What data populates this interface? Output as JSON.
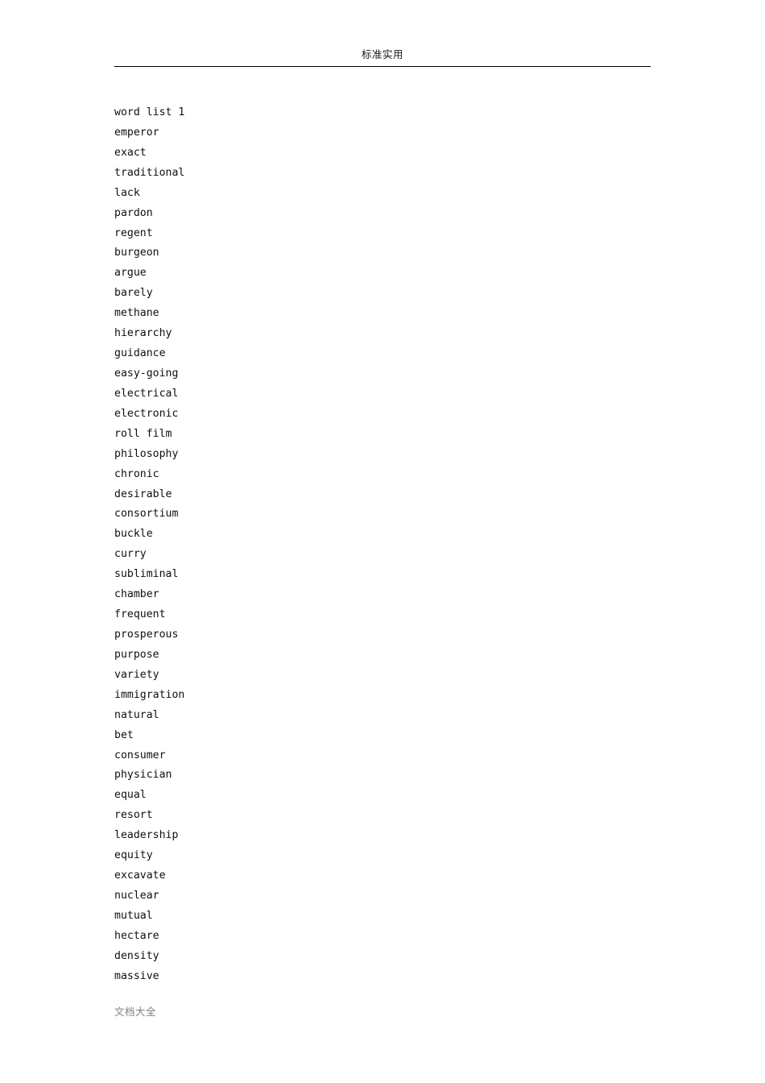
{
  "header": {
    "title": "标准实用"
  },
  "footer": {
    "text": "文档大全"
  },
  "document": {
    "words": [
      "word list 1",
      "emperor",
      "exact",
      "traditional",
      "lack",
      "pardon",
      "regent",
      "burgeon",
      "argue",
      "barely",
      "methane",
      "hierarchy",
      "guidance",
      "easy-going",
      "electrical",
      "electronic",
      "roll film",
      "philosophy",
      "chronic",
      "desirable",
      "consortium",
      "buckle",
      "curry",
      "subliminal",
      "chamber",
      "frequent",
      "prosperous",
      "purpose",
      "variety",
      "immigration",
      "natural",
      "bet",
      "consumer",
      "physician",
      "equal",
      "resort",
      "leadership",
      "equity",
      "excavate",
      "nuclear",
      "mutual",
      "hectare",
      "density",
      "massive"
    ]
  },
  "colors": {
    "text": "#101010",
    "header_text": "#1a1a1a",
    "footer_text": "#808080",
    "rule": "#000000",
    "background": "#ffffff"
  }
}
